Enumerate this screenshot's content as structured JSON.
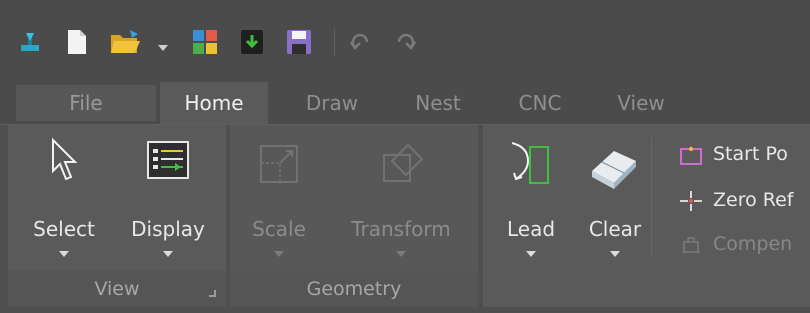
{
  "tabs": {
    "file": "File",
    "home": "Home",
    "draw": "Draw",
    "nest": "Nest",
    "cnc": "CNC",
    "view": "View"
  },
  "groups": {
    "view": {
      "label": "View",
      "buttons": {
        "select": "Select",
        "display": "Display"
      }
    },
    "geometry": {
      "label": "Geometry",
      "buttons": {
        "scale": "Scale",
        "transform": "Transform"
      }
    },
    "cnc": {
      "buttons": {
        "lead": "Lead",
        "clear": "Clear"
      },
      "small_buttons": {
        "start_point": "Start Po",
        "zero_ref": "Zero Ref",
        "compen": "Compen"
      }
    }
  },
  "colors": {
    "ribbon_bg": "#5a5a5a",
    "titlebar_bg": "#4b4b4b",
    "accent_green": "#3fbf3f",
    "save_purple": "#8a6fc9"
  },
  "icons": {
    "qat": [
      "app-icon",
      "new-file-icon",
      "open-folder-icon",
      "dropdown-icon",
      "layout-icon",
      "export-icon",
      "save-icon",
      "undo-icon",
      "redo-icon"
    ]
  }
}
